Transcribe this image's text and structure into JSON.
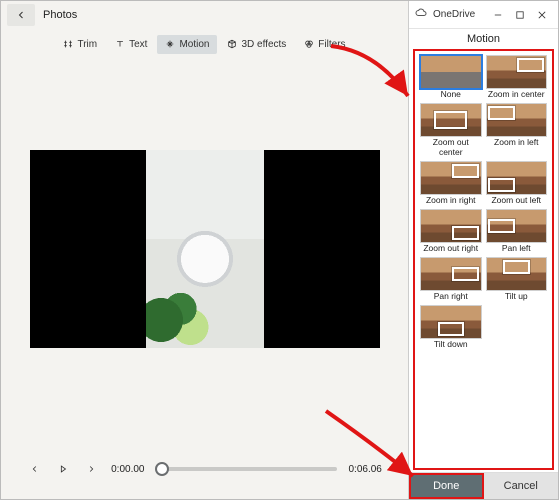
{
  "app": {
    "title": "Photos"
  },
  "toolbar": {
    "trim": "Trim",
    "text": "Text",
    "motion": "Motion",
    "effects": "3D effects",
    "filters": "Filters"
  },
  "playback": {
    "current": "0:00.00",
    "total": "0:06.06"
  },
  "panel": {
    "app_title": "OneDrive",
    "heading": "Motion",
    "done": "Done",
    "cancel": "Cancel"
  },
  "motion_options": [
    {
      "label": "None"
    },
    {
      "label": "Zoom in center"
    },
    {
      "label": "Zoom out center"
    },
    {
      "label": "Zoom in left"
    },
    {
      "label": "Zoom in right"
    },
    {
      "label": "Zoom out left"
    },
    {
      "label": "Zoom out right"
    },
    {
      "label": "Pan left"
    },
    {
      "label": "Pan right"
    },
    {
      "label": "Tilt up"
    },
    {
      "label": "Tilt down"
    }
  ],
  "motion_selected_index": 0
}
